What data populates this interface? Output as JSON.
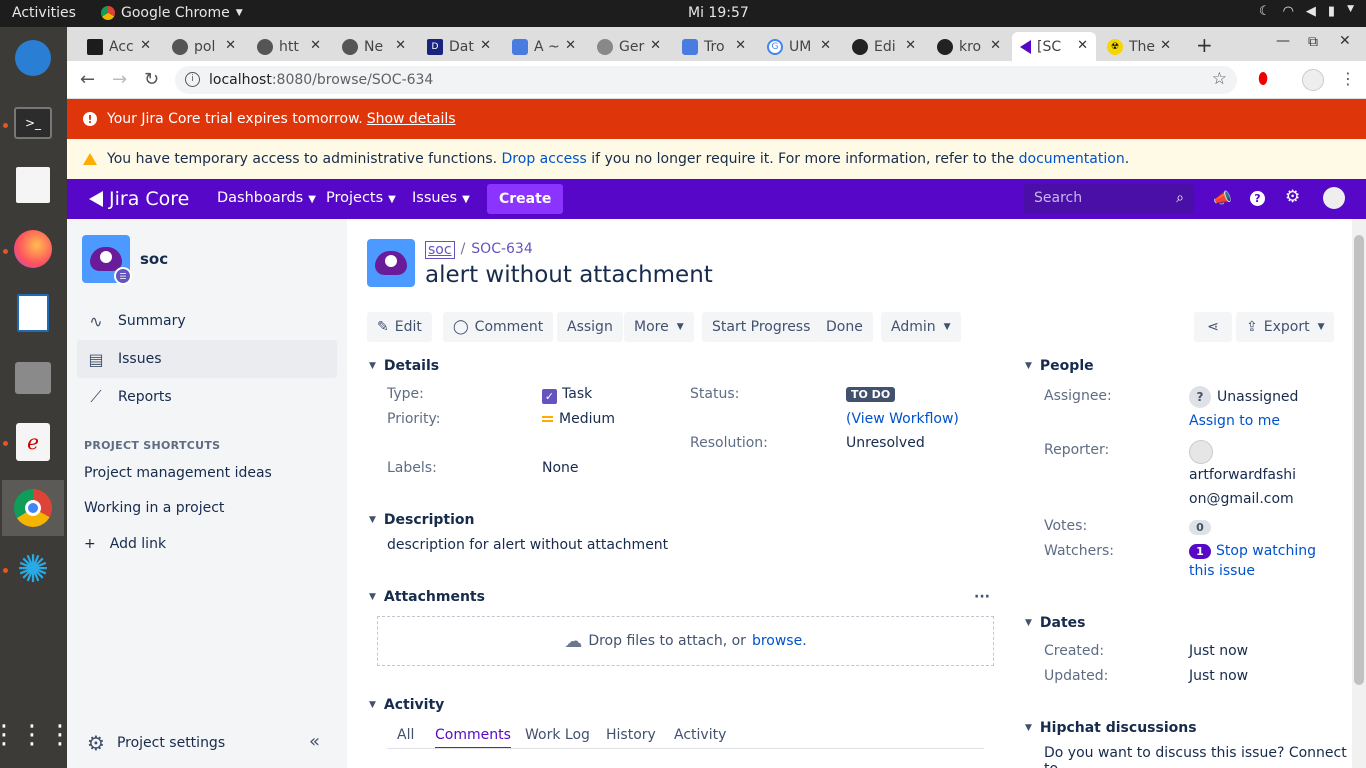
{
  "os": {
    "activities": "Activities",
    "app_name": "Google Chrome",
    "clock": "Mi 19:57"
  },
  "browser": {
    "tabs": [
      {
        "label": "Acc",
        "icon": "terminal-favicon"
      },
      {
        "label": "pol",
        "icon": "globe-favicon"
      },
      {
        "label": "htt",
        "icon": "globe-favicon"
      },
      {
        "label": "Ne",
        "icon": "globe-favicon"
      },
      {
        "label": "Dat",
        "icon": "database-favicon"
      },
      {
        "label": "A ~",
        "icon": "stackedit-favicon"
      },
      {
        "label": "Ger",
        "icon": "gerrit-favicon"
      },
      {
        "label": "Tro",
        "icon": "stackedit-favicon"
      },
      {
        "label": "UM",
        "icon": "google-favicon"
      },
      {
        "label": "Edi",
        "icon": "github-favicon"
      },
      {
        "label": "kro",
        "icon": "github-favicon"
      },
      {
        "label": "[SC",
        "icon": "jira-favicon"
      },
      {
        "label": "The",
        "icon": "radioactive-favicon"
      }
    ],
    "url_host": "localhost",
    "url_path": ":8080/browse/SOC-634"
  },
  "banners": {
    "trial_text": "Your Jira Core trial expires tomorrow.",
    "trial_link": "Show details",
    "admin_text_1": "You have temporary access to administrative functions.",
    "admin_link_1": "Drop access",
    "admin_text_2": "if you no longer require it. For more information, refer to the",
    "admin_link_2": "documentation",
    "admin_text_3": "."
  },
  "jira_nav": {
    "logo": "Jira Core",
    "items": [
      "Dashboards",
      "Projects",
      "Issues"
    ],
    "create": "Create",
    "search_placeholder": "Search",
    "accent": "#5607c7"
  },
  "sidebar": {
    "project_name": "soc",
    "items": [
      {
        "label": "Summary",
        "icon": "pulse-icon"
      },
      {
        "label": "Issues",
        "icon": "issues-icon"
      },
      {
        "label": "Reports",
        "icon": "chart-icon"
      }
    ],
    "shortcuts_heading": "PROJECT SHORTCUTS",
    "shortcuts": [
      "Project management ideas",
      "Working in a project"
    ],
    "add_link": "Add link",
    "settings": "Project settings"
  },
  "issue": {
    "project_crumb": "soc",
    "key": "SOC-634",
    "summary": "alert without attachment",
    "buttons": {
      "edit": "Edit",
      "comment": "Comment",
      "assign": "Assign",
      "more": "More",
      "start_progress": "Start Progress",
      "done": "Done",
      "admin": "Admin",
      "export": "Export"
    },
    "details": {
      "heading": "Details",
      "type_label": "Type:",
      "type_value": "Task",
      "priority_label": "Priority:",
      "priority_value": "Medium",
      "labels_label": "Labels:",
      "labels_value": "None",
      "status_label": "Status:",
      "status_value": "TO DO",
      "view_workflow": "(View Workflow)",
      "resolution_label": "Resolution:",
      "resolution_value": "Unresolved"
    },
    "description": {
      "heading": "Description",
      "text": "description for alert without attachment"
    },
    "attachments": {
      "heading": "Attachments",
      "drop_text": "Drop files to attach, or",
      "browse": "browse."
    },
    "activity": {
      "heading": "Activity",
      "tabs": [
        "All",
        "Comments",
        "Work Log",
        "History",
        "Activity"
      ],
      "selected": "Comments"
    }
  },
  "people": {
    "heading": "People",
    "assignee_label": "Assignee:",
    "assignee_value": "Unassigned",
    "assign_to_me": "Assign to me",
    "reporter_label": "Reporter:",
    "reporter_line1": "artforwardfashi",
    "reporter_line2": "on@gmail.com",
    "votes_label": "Votes:",
    "votes_value": "0",
    "watchers_label": "Watchers:",
    "watchers_value": "1",
    "stop_watching_1": "Stop watching",
    "stop_watching_2": "this issue"
  },
  "dates": {
    "heading": "Dates",
    "created_label": "Created:",
    "created_value": "Just now",
    "updated_label": "Updated:",
    "updated_value": "Just now"
  },
  "hipchat": {
    "heading": "Hipchat discussions",
    "text": "Do you want to discuss this issue? Connect to"
  }
}
